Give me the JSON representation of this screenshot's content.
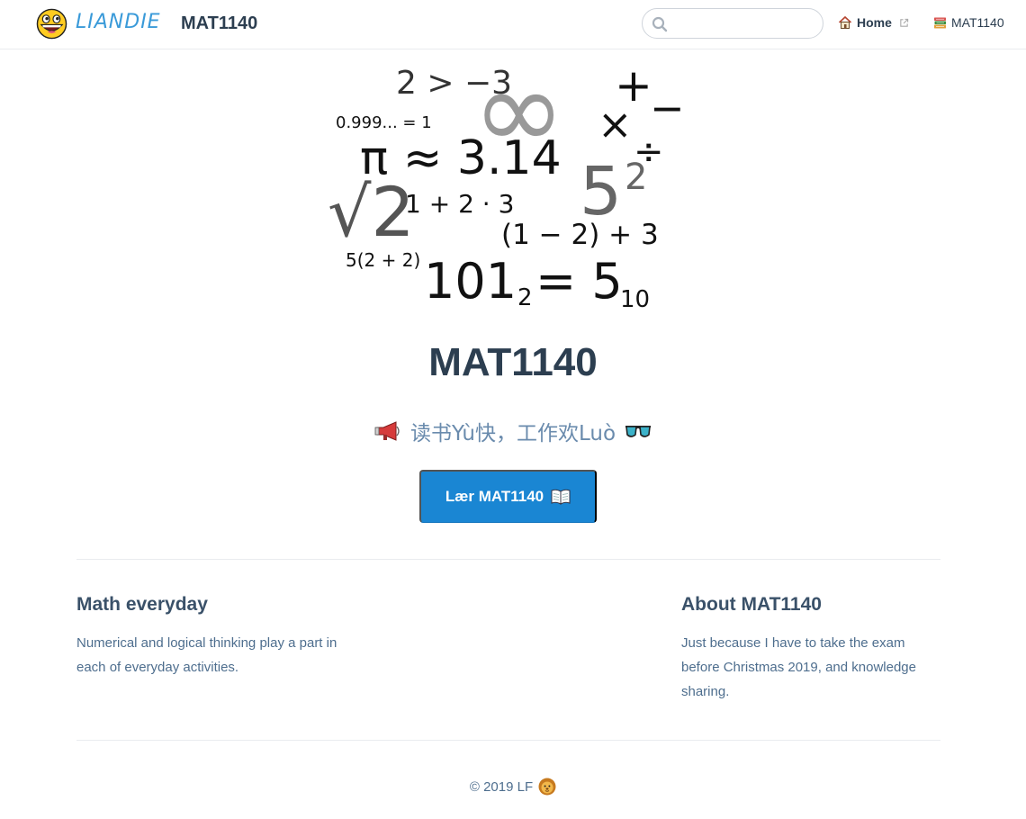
{
  "navbar": {
    "logo_text": "LIANDIE",
    "site_title": "MAT1140",
    "search": {
      "value": "",
      "placeholder": ""
    },
    "links": [
      {
        "label": "Home",
        "icon": "house-icon",
        "external": true
      },
      {
        "label": "MAT1140",
        "icon": "books-icon",
        "external": false
      }
    ]
  },
  "hero": {
    "image_text": {
      "compare": "2 > −3",
      "repeating": "0.999... = 1",
      "pi": "π ≈ 3.14",
      "infinity": "∞",
      "plus_minus_top": "+",
      "plus_minus_bottom": "−",
      "times": "×",
      "divide": "÷",
      "square_base": "5",
      "square_exp": "2",
      "sqrt": "√2",
      "expr_1": "1 + 2 · 3",
      "expr_2": "(1 − 2) + 3",
      "expr_3": "5(2 + 2)",
      "binary_base": "101",
      "binary_sub": "2",
      "equals_five": "= 5",
      "decimal_sub": "10"
    },
    "title": "MAT1140",
    "description": "读书Yù快，工作欢Luò",
    "description_icon_left": "megaphone-icon",
    "description_icon_right": "sunglasses-icon",
    "action_label": "Lær MAT1140",
    "action_icon": "open-book-icon"
  },
  "features": [
    {
      "title": "Math everyday",
      "details": "Numerical and logical thinking play a part in each of everyday activities."
    },
    {
      "title": "About MAT1140",
      "details": "Just because I have to take the exam before Christmas 2019, and knowledge sharing."
    }
  ],
  "footer": {
    "text": "© 2019 LF",
    "icon": "lion-icon"
  },
  "colors": {
    "accent": "#1a86d3",
    "text": "#2c3e50",
    "muted": "#6a8bad",
    "border": "#eaecef",
    "logo_text": "#3a9ad9"
  }
}
